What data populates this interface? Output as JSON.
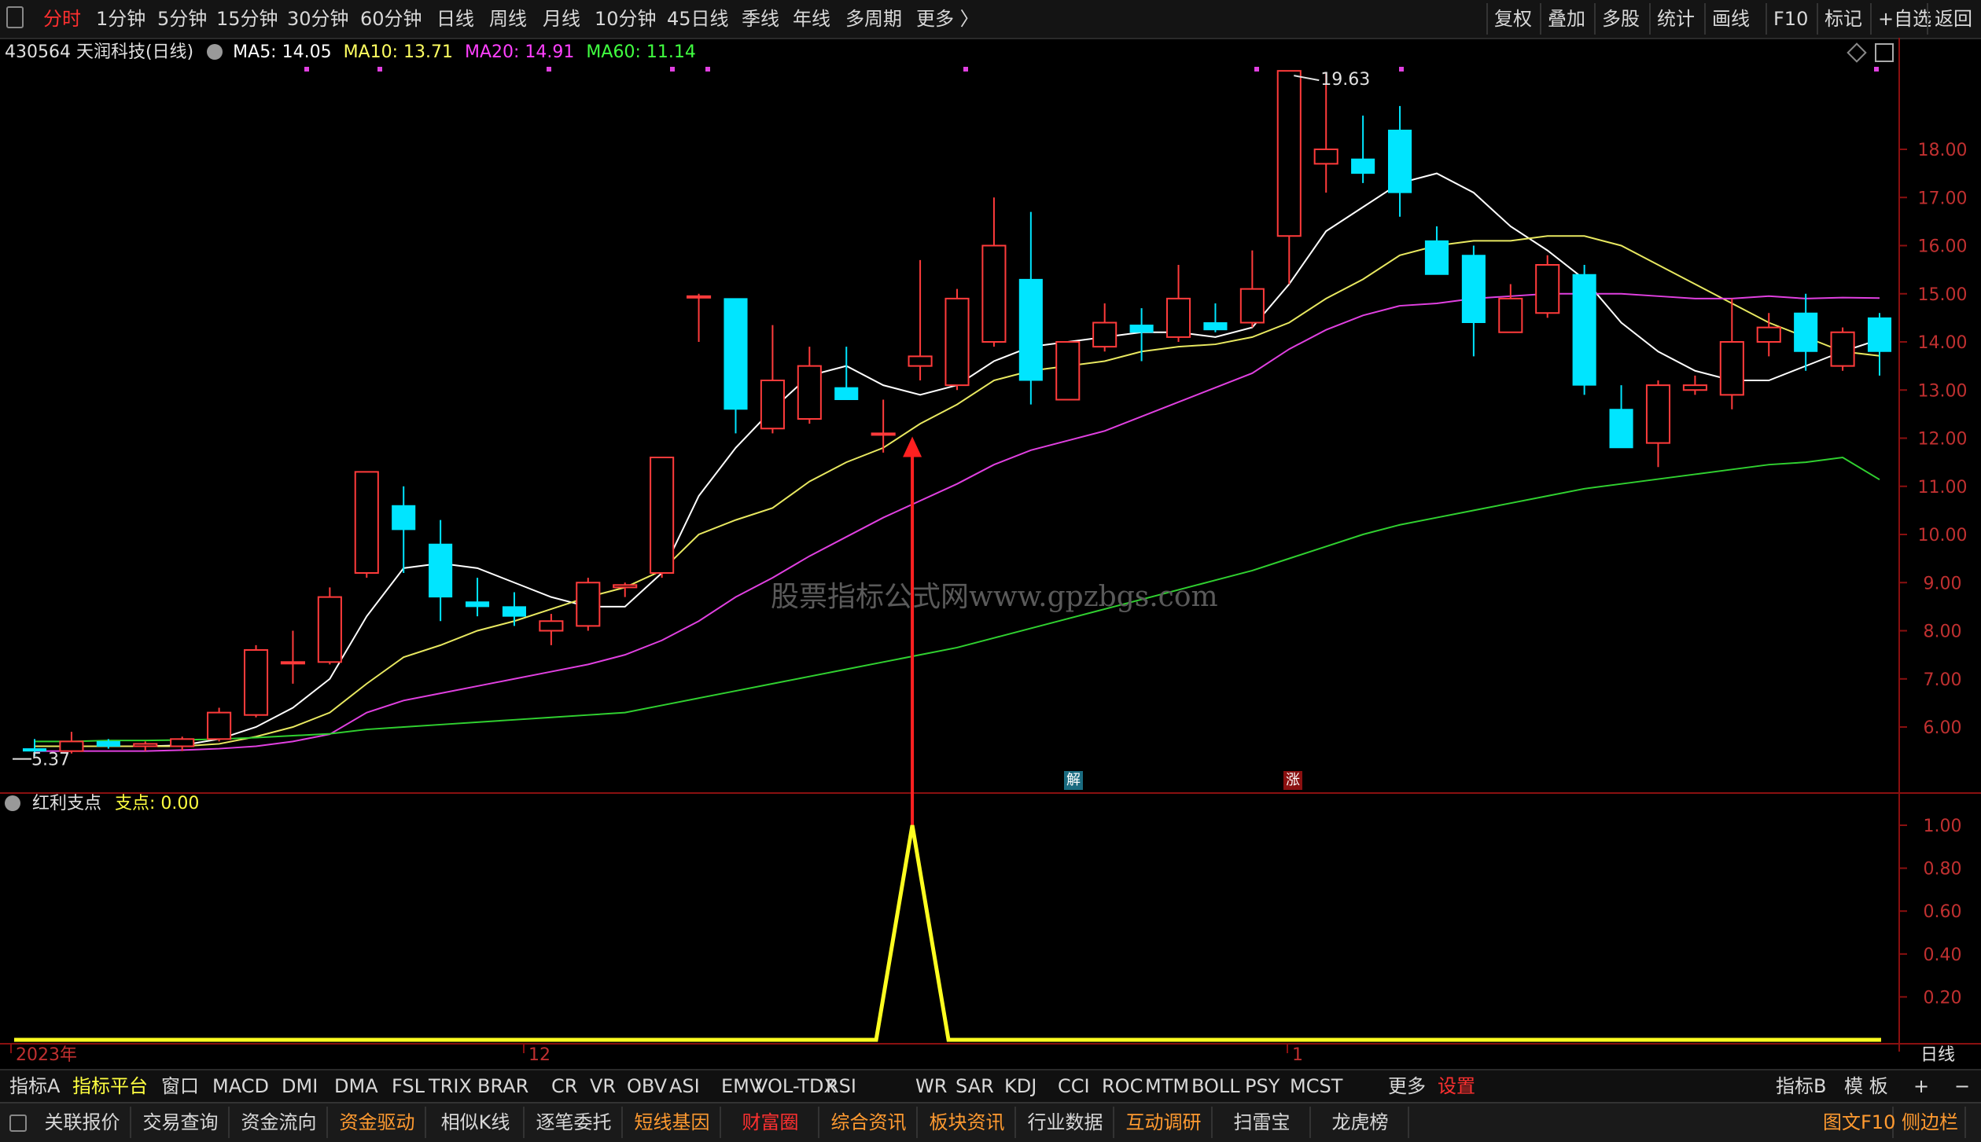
{
  "topbar": {
    "periods": [
      "分时",
      "1分钟",
      "5分钟",
      "15分钟",
      "30分钟",
      "60分钟",
      "日线",
      "周线",
      "月线",
      "10分钟",
      "45日线",
      "季线",
      "年线",
      "多周期",
      "更多 〉"
    ],
    "active": "分时",
    "right": [
      "复权",
      "叠加",
      "多股",
      "统计",
      "画线",
      "F10",
      "标记",
      "+自选",
      "返回"
    ]
  },
  "info": {
    "code_name": "430564 天润科技(日线)",
    "ma5": "MA5: 14.05",
    "ma10": "MA10: 13.71",
    "ma20": "MA20: 14.91",
    "ma60": "MA60: 11.14",
    "colors": {
      "ma5": "#ffffff",
      "ma10": "#ffff60",
      "ma20": "#ff40ff",
      "ma60": "#40ff40"
    }
  },
  "indicator": {
    "name": "红利支点",
    "label": "支点: 0.00"
  },
  "watermark": "股票指标公式网www.gpzbgs.com",
  "annotations": {
    "high": "19.63",
    "low": "5.37",
    "tag_jie": "解",
    "tag_zhang": "涨"
  },
  "indbar": {
    "tabs": [
      "指标A",
      "指标平台",
      "窗口",
      "MACD",
      "DMI",
      "DMA",
      "FSL",
      "TRIX",
      "BRAR",
      "CR",
      "VR",
      "OBV",
      "ASI",
      "EMV",
      "VOL-TDX",
      "RSI",
      "WR",
      "SAR",
      "KDJ",
      "CCI",
      "ROC",
      "MTM",
      "BOLL",
      "PSY",
      "MCST",
      "更多",
      "设置"
    ],
    "right": [
      "指标B",
      "模 板",
      "+",
      "−"
    ]
  },
  "bottombar": {
    "items": [
      "关联报价",
      "交易查询",
      "资金流向",
      "资金驱动",
      "相似K线",
      "逐笔委托",
      "短线基因",
      "财富圈",
      "综合资讯",
      "板块资讯",
      "行业数据",
      "互动调研",
      "扫雷宝",
      "龙虎榜"
    ],
    "right": [
      "图文F10",
      "侧边栏"
    ]
  },
  "chart_data": {
    "type": "candlestick",
    "price_axis": {
      "min": 5.0,
      "max": 20.0,
      "ticks": [
        "18.00",
        "17.00",
        "16.00",
        "15.00",
        "14.00",
        "13.00",
        "12.00",
        "11.00",
        "10.00",
        "9.00",
        "8.00",
        "7.00",
        "6.00"
      ]
    },
    "indicator_axis": {
      "min": 0,
      "max": 1.15,
      "ticks": [
        "1.00",
        "0.80",
        "0.60",
        "0.40",
        "0.20"
      ]
    },
    "x_labels": [
      "2023年",
      "12",
      "1"
    ],
    "period_label": "日线",
    "candles": [
      {
        "o": 5.55,
        "h": 5.75,
        "l": 5.4,
        "c": 5.5
      },
      {
        "o": 5.5,
        "h": 5.9,
        "l": 5.45,
        "c": 5.7
      },
      {
        "o": 5.7,
        "h": 5.75,
        "l": 5.55,
        "c": 5.6
      },
      {
        "o": 5.6,
        "h": 5.7,
        "l": 5.5,
        "c": 5.65
      },
      {
        "o": 5.6,
        "h": 5.8,
        "l": 5.5,
        "c": 5.75
      },
      {
        "o": 5.75,
        "h": 6.4,
        "l": 5.7,
        "c": 6.3
      },
      {
        "o": 6.25,
        "h": 7.7,
        "l": 6.2,
        "c": 7.6
      },
      {
        "o": 7.35,
        "h": 8.0,
        "l": 6.9,
        "c": 7.35
      },
      {
        "o": 7.35,
        "h": 8.9,
        "l": 7.3,
        "c": 8.7
      },
      {
        "o": 9.2,
        "h": 11.3,
        "l": 9.1,
        "c": 11.3
      },
      {
        "o": 10.6,
        "h": 11.0,
        "l": 9.2,
        "c": 10.1
      },
      {
        "o": 9.8,
        "h": 10.3,
        "l": 8.2,
        "c": 8.7
      },
      {
        "o": 8.6,
        "h": 9.1,
        "l": 8.3,
        "c": 8.5
      },
      {
        "o": 8.5,
        "h": 8.8,
        "l": 8.1,
        "c": 8.3
      },
      {
        "o": 8.0,
        "h": 8.35,
        "l": 7.7,
        "c": 8.2
      },
      {
        "o": 8.1,
        "h": 9.1,
        "l": 8.0,
        "c": 9.0
      },
      {
        "o": 8.9,
        "h": 9.0,
        "l": 8.7,
        "c": 8.95
      },
      {
        "o": 9.2,
        "h": 11.6,
        "l": 9.1,
        "c": 11.6
      },
      {
        "o": 14.95,
        "h": 15.0,
        "l": 14.0,
        "c": 14.95
      },
      {
        "o": 14.9,
        "h": 14.9,
        "l": 12.1,
        "c": 12.6
      },
      {
        "o": 12.2,
        "h": 14.35,
        "l": 12.1,
        "c": 13.2
      },
      {
        "o": 12.4,
        "h": 13.9,
        "l": 12.3,
        "c": 13.5
      },
      {
        "o": 13.05,
        "h": 13.9,
        "l": 12.8,
        "c": 12.8
      },
      {
        "o": 12.1,
        "h": 12.8,
        "l": 11.7,
        "c": 12.1
      },
      {
        "o": 13.5,
        "h": 15.7,
        "l": 13.2,
        "c": 13.7
      },
      {
        "o": 13.1,
        "h": 15.1,
        "l": 13.0,
        "c": 14.9
      },
      {
        "o": 14.0,
        "h": 17.0,
        "l": 13.9,
        "c": 16.0
      },
      {
        "o": 15.3,
        "h": 16.7,
        "l": 12.7,
        "c": 13.2
      },
      {
        "o": 12.8,
        "h": 14.0,
        "l": 12.8,
        "c": 14.0
      },
      {
        "o": 13.9,
        "h": 14.8,
        "l": 13.8,
        "c": 14.4
      },
      {
        "o": 14.35,
        "h": 14.7,
        "l": 13.6,
        "c": 14.2
      },
      {
        "o": 14.1,
        "h": 15.6,
        "l": 14.0,
        "c": 14.9
      },
      {
        "o": 14.4,
        "h": 14.8,
        "l": 14.2,
        "c": 14.25
      },
      {
        "o": 14.4,
        "h": 15.9,
        "l": 14.3,
        "c": 15.1
      },
      {
        "o": 16.2,
        "h": 19.63,
        "l": 15.2,
        "c": 19.63
      },
      {
        "o": 17.7,
        "h": 19.6,
        "l": 17.1,
        "c": 18.0
      },
      {
        "o": 17.8,
        "h": 18.7,
        "l": 17.3,
        "c": 17.5
      },
      {
        "o": 18.4,
        "h": 18.9,
        "l": 16.6,
        "c": 17.1
      },
      {
        "o": 16.1,
        "h": 16.4,
        "l": 15.4,
        "c": 15.4
      },
      {
        "o": 15.8,
        "h": 16.0,
        "l": 13.7,
        "c": 14.4
      },
      {
        "o": 14.2,
        "h": 15.2,
        "l": 14.2,
        "c": 14.9
      },
      {
        "o": 14.6,
        "h": 15.8,
        "l": 14.5,
        "c": 15.6
      },
      {
        "o": 15.4,
        "h": 15.6,
        "l": 12.9,
        "c": 13.1
      },
      {
        "o": 12.6,
        "h": 13.1,
        "l": 11.8,
        "c": 11.8
      },
      {
        "o": 11.9,
        "h": 13.2,
        "l": 11.4,
        "c": 13.1
      },
      {
        "o": 13.0,
        "h": 13.3,
        "l": 12.9,
        "c": 13.1
      },
      {
        "o": 12.9,
        "h": 14.9,
        "l": 12.6,
        "c": 14.0
      },
      {
        "o": 14.0,
        "h": 14.6,
        "l": 13.7,
        "c": 14.3
      },
      {
        "o": 14.6,
        "h": 15.0,
        "l": 13.4,
        "c": 13.8
      },
      {
        "o": 13.5,
        "h": 14.3,
        "l": 13.4,
        "c": 14.2
      },
      {
        "o": 14.5,
        "h": 14.6,
        "l": 13.3,
        "c": 13.8
      }
    ],
    "series": [
      {
        "name": "MA5",
        "values": [
          5.6,
          5.6,
          5.6,
          5.6,
          5.62,
          5.75,
          6.0,
          6.4,
          7.0,
          8.3,
          9.3,
          9.4,
          9.3,
          9.0,
          8.7,
          8.5,
          8.5,
          9.2,
          10.8,
          11.8,
          12.6,
          13.3,
          13.5,
          13.1,
          12.9,
          13.1,
          13.6,
          13.9,
          14.0,
          14.1,
          14.2,
          14.2,
          14.1,
          14.3,
          15.2,
          16.3,
          16.8,
          17.3,
          17.5,
          17.1,
          16.4,
          15.9,
          15.3,
          14.4,
          13.8,
          13.4,
          13.2,
          13.2,
          13.5,
          13.8,
          14.05
        ]
      },
      {
        "name": "MA10",
        "values": [
          5.6,
          5.6,
          5.6,
          5.6,
          5.6,
          5.65,
          5.8,
          6.0,
          6.3,
          6.9,
          7.45,
          7.7,
          8.0,
          8.2,
          8.45,
          8.7,
          8.9,
          9.25,
          10.0,
          10.3,
          10.55,
          11.1,
          11.5,
          11.8,
          12.3,
          12.7,
          13.2,
          13.4,
          13.5,
          13.6,
          13.8,
          13.9,
          13.95,
          14.1,
          14.4,
          14.9,
          15.3,
          15.8,
          16.0,
          16.1,
          16.1,
          16.2,
          16.2,
          16.0,
          15.6,
          15.2,
          14.8,
          14.4,
          14.1,
          13.8,
          13.71
        ]
      },
      {
        "name": "MA20",
        "values": [
          5.5,
          5.5,
          5.5,
          5.5,
          5.52,
          5.55,
          5.6,
          5.7,
          5.85,
          6.3,
          6.55,
          6.7,
          6.85,
          7.0,
          7.15,
          7.3,
          7.5,
          7.8,
          8.2,
          8.7,
          9.1,
          9.55,
          9.95,
          10.35,
          10.7,
          11.05,
          11.45,
          11.75,
          11.95,
          12.15,
          12.45,
          12.75,
          13.05,
          13.35,
          13.85,
          14.25,
          14.55,
          14.75,
          14.8,
          14.9,
          14.95,
          15.0,
          15.0,
          15.0,
          14.95,
          14.9,
          14.9,
          14.95,
          14.9,
          14.92,
          14.91
        ]
      },
      {
        "name": "MA60",
        "values": [
          5.7,
          5.7,
          5.72,
          5.72,
          5.73,
          5.75,
          5.78,
          5.82,
          5.86,
          5.95,
          6.0,
          6.05,
          6.1,
          6.15,
          6.2,
          6.25,
          6.3,
          6.45,
          6.6,
          6.75,
          6.9,
          7.05,
          7.2,
          7.35,
          7.5,
          7.65,
          7.85,
          8.05,
          8.25,
          8.45,
          8.65,
          8.85,
          9.05,
          9.25,
          9.5,
          9.75,
          10.0,
          10.2,
          10.35,
          10.5,
          10.65,
          10.8,
          10.95,
          11.05,
          11.15,
          11.25,
          11.35,
          11.45,
          11.5,
          11.6,
          11.14
        ]
      }
    ],
    "indicator": {
      "name": "支点",
      "values": [
        0,
        0,
        0,
        0,
        0,
        0,
        0,
        0,
        0,
        0,
        0,
        0,
        0,
        0,
        0,
        0,
        0,
        0,
        0,
        0,
        0,
        0,
        0,
        0,
        1,
        0,
        0,
        0,
        0,
        0,
        0,
        0,
        0,
        0,
        0,
        0,
        0,
        0,
        0,
        0,
        0,
        0,
        0,
        0,
        0,
        0,
        0,
        0,
        0,
        0,
        0
      ]
    },
    "signal_index": 24
  }
}
